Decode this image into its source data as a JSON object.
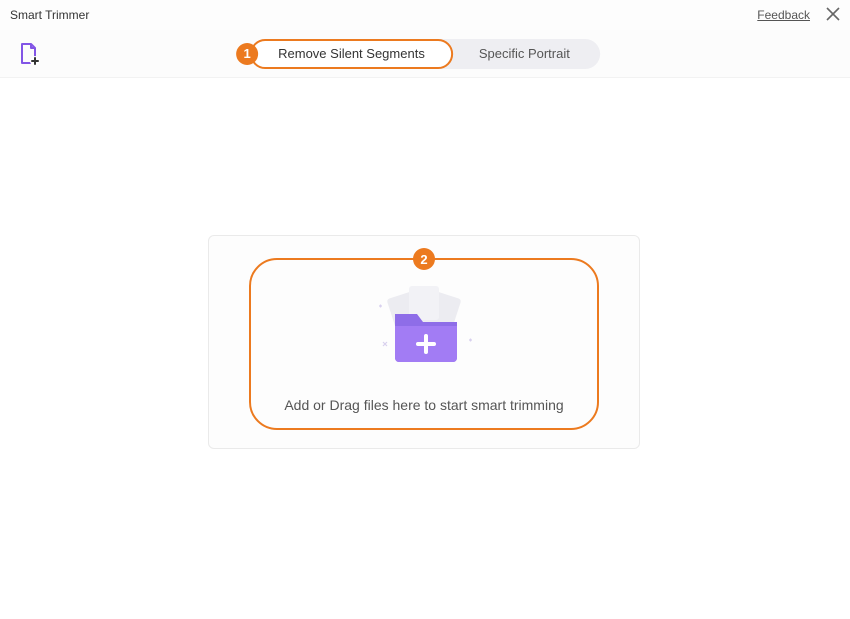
{
  "titlebar": {
    "title": "Smart Trimmer",
    "feedback": "Feedback"
  },
  "tabs": {
    "remove_silent": "Remove Silent Segments",
    "specific_portrait": "Specific Portrait"
  },
  "steps": {
    "one": "1",
    "two": "2"
  },
  "drop": {
    "prompt": "Add or Drag files here to start smart trimming"
  }
}
